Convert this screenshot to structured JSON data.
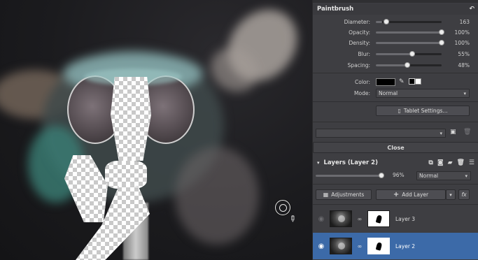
{
  "paintbrush": {
    "title": "Paintbrush",
    "reset_icon": "undo-arrow-icon",
    "sliders": [
      {
        "label": "Diameter:",
        "value": "163",
        "level": 0.1
      },
      {
        "label": "Opacity:",
        "value": "100%",
        "level": 1.0
      },
      {
        "label": "Density:",
        "value": "100%",
        "level": 1.0
      },
      {
        "label": "Blur:",
        "value": "55%",
        "level": 0.55
      },
      {
        "label": "Spacing:",
        "value": "48%",
        "level": 0.48
      }
    ],
    "color_label": "Color:",
    "color_value": "#000000",
    "mode_label": "Mode:",
    "mode_value": "Normal",
    "tablet_button": "Tablet Settings...",
    "close_button": "Close"
  },
  "layers": {
    "title": "Layers (Layer 2)",
    "opacity_value": "96%",
    "opacity_level": 0.96,
    "blend_mode": "Normal",
    "adjustments_button": "Adjustments",
    "add_layer_button": "Add Layer",
    "fx_button": "fx",
    "items": [
      {
        "name": "Layer 3",
        "visible": false,
        "selected": false
      },
      {
        "name": "Layer 2",
        "visible": true,
        "selected": true
      }
    ]
  },
  "colors": {
    "panel_bg": "#3e3e42",
    "selection": "#3c6aa8",
    "canvas_bg": "#1b1b1e"
  }
}
